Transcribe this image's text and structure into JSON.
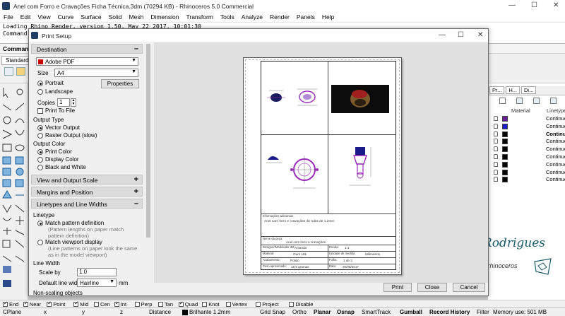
{
  "app": {
    "title": "Anel com Forro e Cravações Ficha Técnica.3dm (70294 KB) - Rhinoceros 5.0 Commercial",
    "window_controls": [
      "—",
      "☐",
      "✕"
    ]
  },
  "menu": [
    "File",
    "Edit",
    "View",
    "Curve",
    "Surface",
    "Solid",
    "Mesh",
    "Dimension",
    "Transform",
    "Tools",
    "Analyze",
    "Render",
    "Panels",
    "Help"
  ],
  "command_history": [
    "Loading Rhino Render, version 1.50, May 22 2017, 10:01:30",
    "Command"
  ],
  "command_prompt": "Command",
  "toolbar_tab": "Standard",
  "dialog": {
    "title": "Print Setup",
    "sections": {
      "destination": "Destination",
      "view_output_scale": "View and Output Scale",
      "margins_position": "Margins and Position",
      "linetypes": "Linetypes and Line Widths"
    },
    "printer": "Adobe PDF",
    "size_label": "Size",
    "size": "A4",
    "portrait": "Portrait",
    "landscape": "Landscape",
    "properties_button": "Properties",
    "copies_label": "Copies",
    "copies": "1",
    "print_to_file": "Print To File",
    "output_type_label": "Output Type",
    "vector_output": "Vector Output",
    "raster_output": "Raster Output (slow)",
    "output_color_label": "Output Color",
    "print_color": "Print Color",
    "display_color": "Display Color",
    "black_white": "Black and White",
    "linetype_label": "Linetype",
    "match_pattern": "Match pattern definition",
    "match_pattern_note": "(Pattern lengths on paper match pattern definition)",
    "match_viewport": "Match viewport display",
    "match_viewport_note": "(Line patterns on paper look the same as in the model viewport)",
    "line_width_label": "Line Width",
    "scale_by_label": "Scale by",
    "scale_by": "1.0",
    "default_width_label": "Default line width",
    "default_width": "Hairline",
    "unit": "mm",
    "non_scaling": "Non-scaling objects",
    "buttons": {
      "print": "Print",
      "close": "Close",
      "cancel": "Cancel"
    }
  },
  "sheet": {
    "info_header": "Informações adicionais",
    "info_text": "Anel com forro e cravações de rubis de 1.2mm",
    "piece_label": "Nome da peça:",
    "piece": "Anel com forro e cravações",
    "designer_label": "Designer/Modelador 3D:",
    "designer": "Amanda",
    "scale_label": "Escala:",
    "scale": "1:1",
    "material_label": "Material:",
    "material": "Ouro 18k",
    "unit_label": "Unidade de medida:",
    "unit": "Milímetros",
    "finish_label": "Acabamento:",
    "finish": "Polido",
    "sheet_label": "Folha:",
    "sheet": "1 de 3",
    "weight_label": "Peso aproximado:",
    "weight": "18,5 gramas",
    "date_label": "Data:",
    "date": "25/08/2017"
  },
  "layers": {
    "tabs": [
      "Pr...",
      "H...",
      "Di..."
    ],
    "col_material": "Material",
    "col_linetype": "Linetype",
    "rows": [
      {
        "color": "#6a1b9a",
        "linetype": "Continuou",
        "bold": false
      },
      {
        "color": "#1a1acc",
        "linetype": "Continuou",
        "bold": false
      },
      {
        "color": "#000000",
        "linetype": "Continuo",
        "bold": true
      },
      {
        "color": "#000000",
        "linetype": "Continuou",
        "bold": false
      },
      {
        "color": "#000000",
        "linetype": "Continuou",
        "bold": false
      },
      {
        "color": "#000000",
        "linetype": "Continuou",
        "bold": false
      },
      {
        "color": "#000000",
        "linetype": "Continuou",
        "bold": false
      },
      {
        "color": "#000000",
        "linetype": "Continuou",
        "bold": false
      },
      {
        "color": "#000000",
        "linetype": "Continuou",
        "bold": false
      }
    ]
  },
  "watermark": {
    "name": "Amanda Rodrigues",
    "tagline": "joias com rhinoceros"
  },
  "osnaps": [
    {
      "label": "End",
      "on": true
    },
    {
      "label": "Near",
      "on": true
    },
    {
      "label": "Point",
      "on": true
    },
    {
      "label": "Mid",
      "on": true
    },
    {
      "label": "Cen",
      "on": false
    },
    {
      "label": "Int",
      "on": true
    },
    {
      "label": "Perp",
      "on": false
    },
    {
      "label": "Tan",
      "on": false
    },
    {
      "label": "Quad",
      "on": true
    },
    {
      "label": "Knot",
      "on": false
    },
    {
      "label": "Vertex",
      "on": false
    },
    {
      "label": "Project",
      "on": false
    },
    {
      "label": "Disable",
      "on": false
    }
  ],
  "status": {
    "cplane": "CPlane",
    "x": "x",
    "y": "y",
    "z": "z",
    "distance": "Distance",
    "layer": "Brilhante 1.2mm",
    "grid_snap": "Grid Snap",
    "ortho": "Ortho",
    "planar": "Planar",
    "osnap": "Osnap",
    "smarttrack": "SmartTrack",
    "gumball": "Gumball",
    "record_history": "Record History",
    "filter": "Filter",
    "memory": "Memory use: 501 MB"
  }
}
